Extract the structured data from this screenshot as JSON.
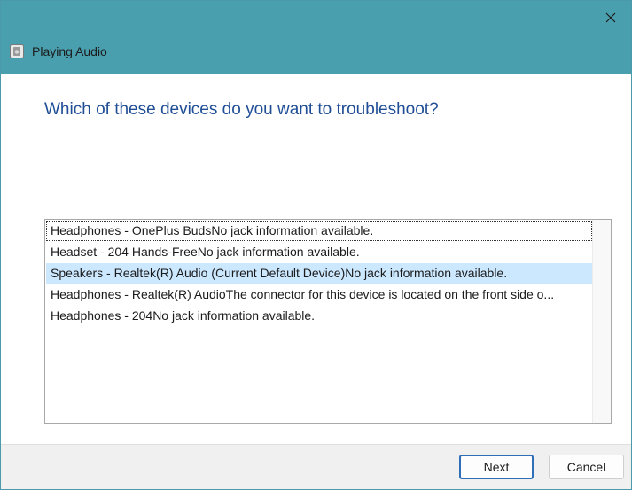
{
  "window": {
    "title": "Playing Audio",
    "icon": "speaker-troubleshooter-icon",
    "close_icon": "close-icon",
    "accent": "#4a9faf"
  },
  "main": {
    "heading": "Which of these devices do you want to troubleshoot?",
    "devices": [
      {
        "label": "Headphones - OnePlus BudsNo jack information available.",
        "state": "focused"
      },
      {
        "label": "Headset - 204 Hands-FreeNo jack information available.",
        "state": "normal"
      },
      {
        "label": "Speakers - Realtek(R) Audio (Current Default Device)No jack information available.",
        "state": "selected"
      },
      {
        "label": "Headphones - Realtek(R) AudioThe connector for this device is located on the front side o...",
        "state": "normal"
      },
      {
        "label": "Headphones - 204No jack information available.",
        "state": "normal"
      }
    ]
  },
  "footer": {
    "next_label": "Next",
    "cancel_label": "Cancel"
  }
}
